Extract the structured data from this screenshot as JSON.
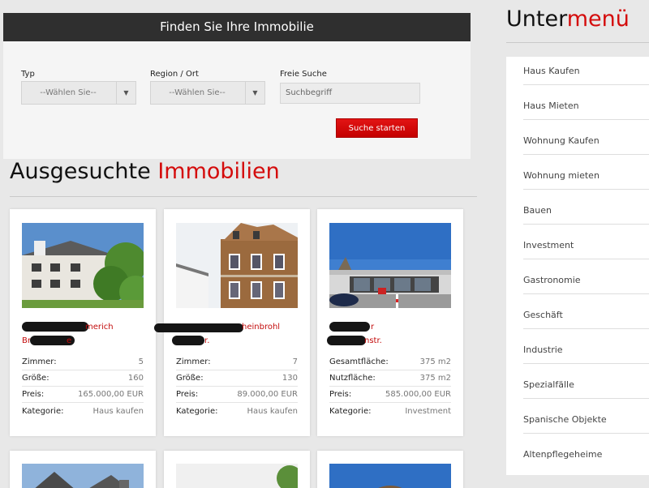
{
  "search": {
    "header": "Finden Sie Ihre Immobilie",
    "type_label": "Typ",
    "type_value": "--Wählen Sie--",
    "region_label": "Region / Ort",
    "region_value": "--Wählen Sie--",
    "free_label": "Freie Suche",
    "free_placeholder": "Suchbegriff",
    "button": "Suche starten"
  },
  "section": {
    "title_main": "Ausgesuchte",
    "title_accent": "Immobilien"
  },
  "cards": [
    {
      "line1_tail": "merich",
      "line2_head": "Br",
      "line2_tail": "e",
      "rows": [
        {
          "k": "Zimmer:",
          "v": "5"
        },
        {
          "k": "Größe:",
          "v": "160"
        },
        {
          "k": "Preis:",
          "v": "165.000,00 EUR"
        },
        {
          "k": "Kategorie:",
          "v": "Haus kaufen"
        }
      ]
    },
    {
      "line1_tail": "heinbrohl",
      "line2_head": "",
      "line2_tail": "r.",
      "rows": [
        {
          "k": "Zimmer:",
          "v": "7"
        },
        {
          "k": "Größe:",
          "v": "130"
        },
        {
          "k": "Preis:",
          "v": "89.000,00 EUR"
        },
        {
          "k": "Kategorie:",
          "v": "Haus kaufen"
        }
      ]
    },
    {
      "line1_tail": "r",
      "line2_head": "",
      "line2_tail": "nstr.",
      "rows": [
        {
          "k": "Gesamtfläche:",
          "v": "375 m2"
        },
        {
          "k": "Nutzfläche:",
          "v": "375 m2"
        },
        {
          "k": "Preis:",
          "v": "585.000,00 EUR"
        },
        {
          "k": "Kategorie:",
          "v": "Investment"
        }
      ]
    }
  ],
  "sidebar": {
    "title_main": "Unter",
    "title_accent": "menü",
    "items": [
      "Haus Kaufen",
      "Haus Mieten",
      "Wohnung Kaufen",
      "Wohnung mieten",
      "Bauen",
      "Investment",
      "Gastronomie",
      "Geschäft",
      "Industrie",
      "Spezialfälle",
      "Spanische Objekte",
      "Altenpflegeheime"
    ]
  },
  "colors": {
    "accent": "#d40c0c",
    "header_bg": "#2f2f2f",
    "button": "#d30f0f"
  }
}
